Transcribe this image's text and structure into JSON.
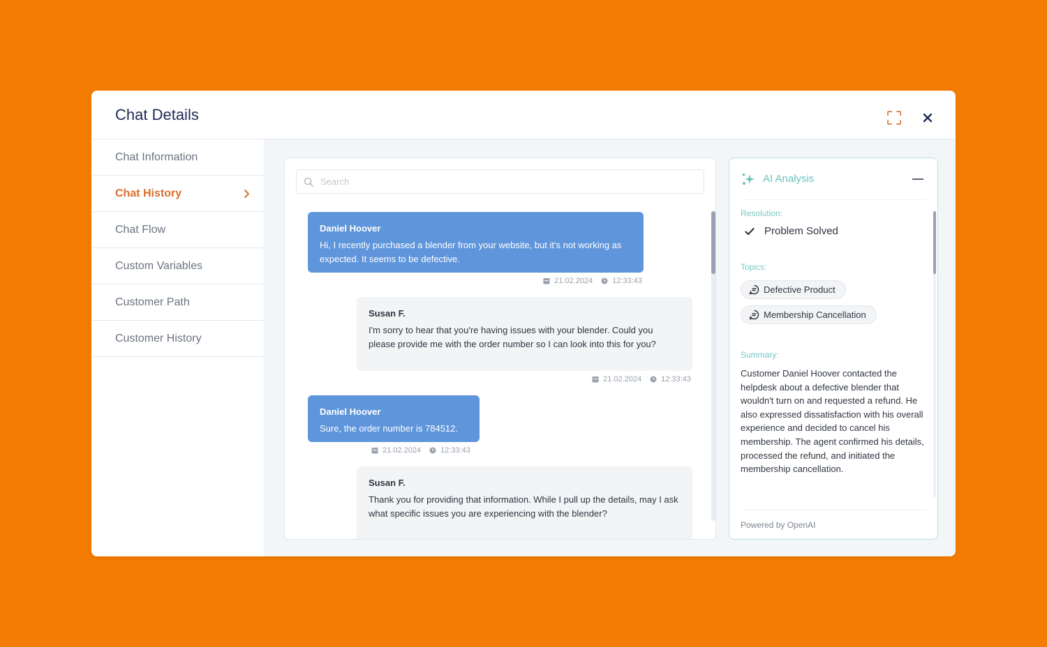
{
  "modal": {
    "title": "Chat Details",
    "icons": {
      "expand": "expand-icon",
      "close": "close-icon"
    }
  },
  "sidebar": {
    "items": [
      {
        "label": "Chat Information",
        "active": false
      },
      {
        "label": "Chat History",
        "active": true
      },
      {
        "label": "Chat Flow",
        "active": false
      },
      {
        "label": "Custom Variables",
        "active": false
      },
      {
        "label": "Customer Path",
        "active": false
      },
      {
        "label": "Customer History",
        "active": false
      }
    ]
  },
  "chat": {
    "search": {
      "placeholder": "Search",
      "value": ""
    },
    "messages": [
      {
        "role": "customer",
        "sender": "Daniel Hoover",
        "text": "Hi, I recently purchased a blender from your website, but it's not working as expected. It seems to be defective.",
        "date": "21.02.2024",
        "time": "12:33:43"
      },
      {
        "role": "agent",
        "sender": "Susan F.",
        "text": "I'm sorry to hear that you're having issues with your blender. Could you please provide me with the order number so I can look into this for you?",
        "date": "21.02.2024",
        "time": "12:33:43"
      },
      {
        "role": "customer",
        "sender": "Daniel Hoover",
        "text": "Sure, the order number is 784512.",
        "date": "21.02.2024",
        "time": "12:33:43"
      },
      {
        "role": "agent",
        "sender": "Susan F.",
        "text": "Thank you for providing that information. While I pull up the details, may I ask what specific issues you are experiencing with the blender?",
        "date": "",
        "time": ""
      }
    ]
  },
  "ai": {
    "title": "AI Analysis",
    "resolution_label": "Resolution:",
    "resolution_value": "Problem Solved",
    "topics_label": "Topics:",
    "topics": [
      "Defective Product",
      "Membership Cancellation"
    ],
    "summary_label": "Summary:",
    "summary": "Customer Daniel Hoover contacted the helpdesk about a defective blender that wouldn't turn on and requested a refund. He also expressed dissatisfaction with his overall experience and decided to cancel his membership. The agent confirmed his details, processed the refund, and initiated the membership cancellation.",
    "footer": "Powered by OpenAI"
  },
  "colors": {
    "background": "#f47c03",
    "accent_active": "#d9702c",
    "customer_bubble": "#5f95db",
    "agent_bubble": "#f3f4f6",
    "ai_accent": "#6cc1bf"
  }
}
